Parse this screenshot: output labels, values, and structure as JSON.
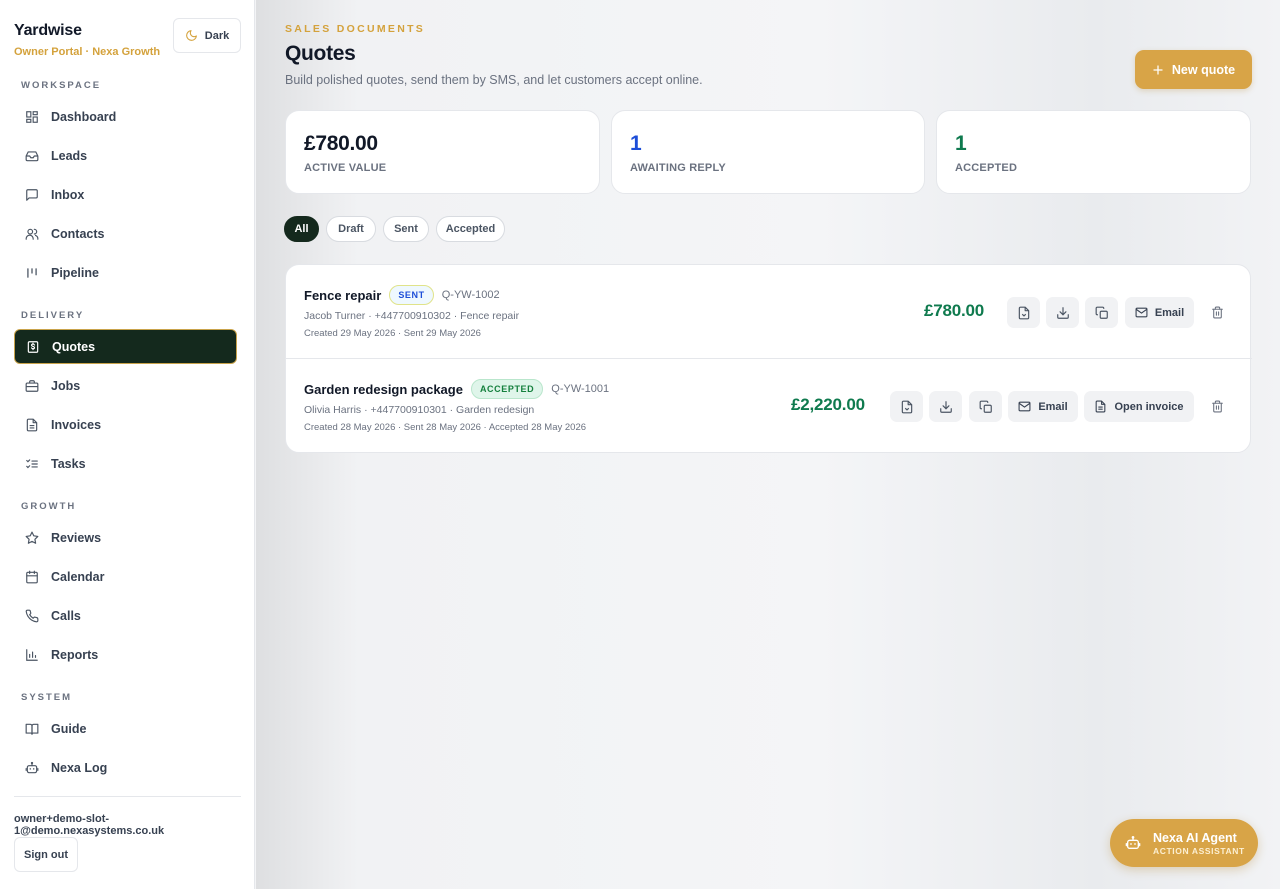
{
  "brand": {
    "name": "Yardwise",
    "subtitle": "Owner Portal · Nexa Growth"
  },
  "theme_toggle": {
    "label": "Dark"
  },
  "sidebar": {
    "sections": [
      {
        "title": "WORKSPACE",
        "items": [
          {
            "label": "Dashboard",
            "icon": "dashboard-icon"
          },
          {
            "label": "Leads",
            "icon": "inbox-tray-icon"
          },
          {
            "label": "Inbox",
            "icon": "message-icon"
          },
          {
            "label": "Contacts",
            "icon": "users-icon"
          },
          {
            "label": "Pipeline",
            "icon": "pipeline-icon"
          }
        ]
      },
      {
        "title": "DELIVERY",
        "items": [
          {
            "label": "Quotes",
            "icon": "receipt-icon",
            "active": true
          },
          {
            "label": "Jobs",
            "icon": "briefcase-icon"
          },
          {
            "label": "Invoices",
            "icon": "document-icon"
          },
          {
            "label": "Tasks",
            "icon": "checklist-icon"
          }
        ]
      },
      {
        "title": "GROWTH",
        "items": [
          {
            "label": "Reviews",
            "icon": "star-icon"
          },
          {
            "label": "Calendar",
            "icon": "calendar-icon"
          },
          {
            "label": "Calls",
            "icon": "phone-icon"
          },
          {
            "label": "Reports",
            "icon": "bar-chart-icon"
          }
        ]
      },
      {
        "title": "SYSTEM",
        "items": [
          {
            "label": "Guide",
            "icon": "book-icon"
          },
          {
            "label": "Nexa Log",
            "icon": "bot-icon"
          }
        ]
      }
    ],
    "user_email": "owner+demo-slot-1@demo.nexasystems.co.uk",
    "sign_out_label": "Sign out"
  },
  "header": {
    "eyebrow": "SALES DOCUMENTS",
    "title": "Quotes",
    "subtitle": "Build polished quotes, send them by SMS, and let customers accept online.",
    "new_quote_label": "New quote"
  },
  "stats": [
    {
      "value": "£780.00",
      "label": "ACTIVE VALUE",
      "color": "#111827"
    },
    {
      "value": "1",
      "label": "AWAITING REPLY",
      "color": "#1d4ed8"
    },
    {
      "value": "1",
      "label": "ACCEPTED",
      "color": "#0f7a4e"
    }
  ],
  "filters": [
    {
      "label": "All",
      "active": true
    },
    {
      "label": "Draft"
    },
    {
      "label": "Sent"
    },
    {
      "label": "Accepted"
    }
  ],
  "quotes": [
    {
      "title": "Fence repair",
      "status": "SENT",
      "reference": "Q-YW-1002",
      "meta": "Jacob Turner · +447700910302 · Fence repair",
      "dates": "Created 29 May 2026 · Sent 29 May 2026",
      "amount": "£780.00",
      "email_label": "Email"
    },
    {
      "title": "Garden redesign package",
      "status": "ACCEPTED",
      "reference": "Q-YW-1001",
      "meta": "Olivia Harris · +447700910301 · Garden redesign",
      "dates": "Created 28 May 2026 · Sent 28 May 2026 · Accepted 28 May 2026",
      "amount": "£2,220.00",
      "email_label": "Email",
      "open_invoice_label": "Open invoice"
    }
  ],
  "agent": {
    "title": "Nexa AI Agent",
    "subtitle": "ACTION ASSISTANT"
  },
  "colors": {
    "accent": "#d8a447",
    "active_nav": "#14291d",
    "amount_green": "#0f7a4e"
  }
}
